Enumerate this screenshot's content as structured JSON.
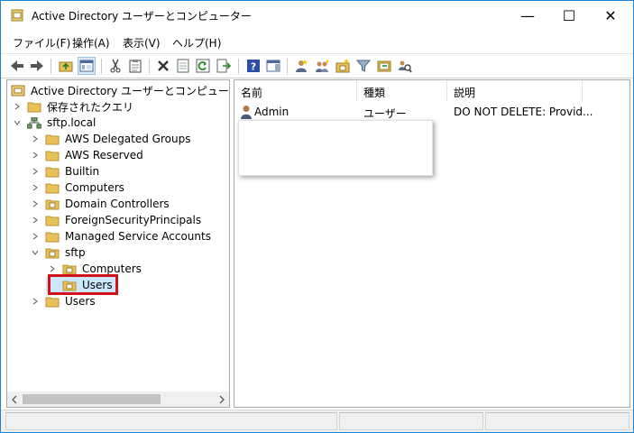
{
  "window": {
    "title": "Active Directory ユーザーとコンピューター",
    "controls": {
      "minimize": "—",
      "maximize": "☐",
      "close": "✕"
    }
  },
  "menu": [
    "ファイル(F)",
    "操作(A)",
    "表示(V)",
    "ヘルプ(H)"
  ],
  "toolbar": {
    "icons": [
      "back-arrow-icon",
      "forward-arrow-icon",
      "up-folder-icon",
      "console-tree-icon",
      "cut-icon",
      "clipboard-icon",
      "delete-icon",
      "properties-icon",
      "refresh-icon",
      "export-list-icon",
      "help-icon",
      "action-pane-icon",
      "new-user-icon",
      "new-group-icon",
      "new-ou-icon",
      "filter-icon",
      "add-to-group-icon",
      "find-icon"
    ]
  },
  "tree": {
    "root": "Active Directory ユーザーとコンピューター [IP-C",
    "saved_queries": "保存されたクエリ",
    "domain": "sftp.local",
    "children": [
      "AWS Delegated Groups",
      "AWS Reserved",
      "Builtin",
      "Computers",
      "Domain Controllers",
      "ForeignSecurityPrincipals",
      "Managed Service Accounts"
    ],
    "sftp": {
      "label": "sftp",
      "children": [
        "Computers",
        "Users"
      ]
    },
    "users": "Users"
  },
  "list": {
    "columns": [
      "名前",
      "種類",
      "説明"
    ],
    "rows": [
      {
        "name": "Admin",
        "type": "ユーザー",
        "description": "DO NOT DELETE:  Provid..."
      }
    ]
  },
  "colors": {
    "accent": "#1883d7",
    "highlight": "#d4121b",
    "folder": "#e8c15a"
  }
}
